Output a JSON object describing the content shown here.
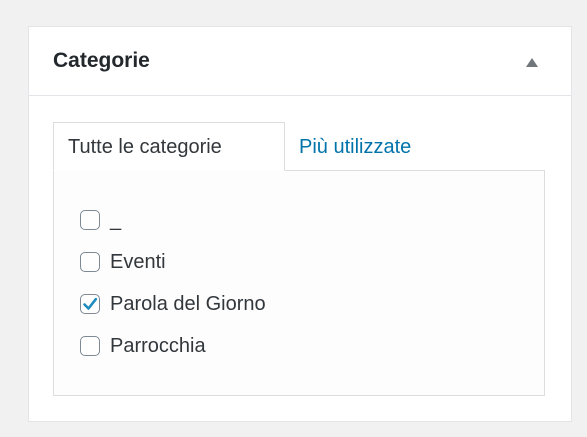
{
  "postbox": {
    "title": "Categorie",
    "toggle_icon": "triangle-up-icon"
  },
  "tabs": [
    {
      "label": "Tutte le categorie",
      "active": true
    },
    {
      "label": "Più utilizzate",
      "active": false
    }
  ],
  "categories": [
    {
      "label": "_",
      "checked": false
    },
    {
      "label": "Eventi",
      "checked": false
    },
    {
      "label": "Parola del Giorno",
      "checked": true
    },
    {
      "label": "Parrocchia",
      "checked": false
    }
  ],
  "colors": {
    "link": "#0073aa",
    "check": "#1e8cbe",
    "background": "#f1f1f1"
  }
}
